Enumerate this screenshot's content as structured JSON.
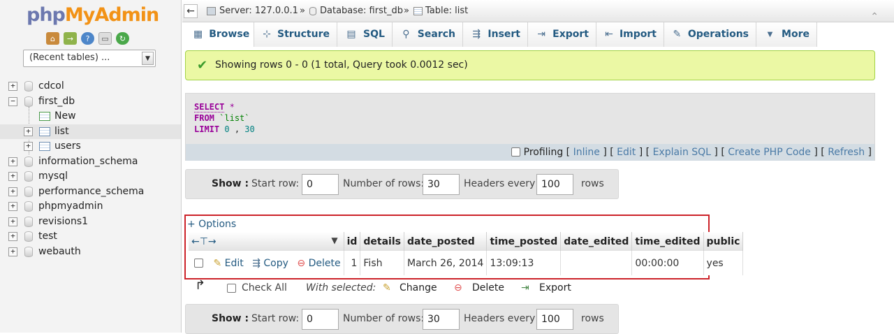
{
  "sidebar": {
    "logo_php": "php",
    "logo_myadmin": "MyAdmin",
    "quick_icons": [
      "home-icon",
      "logout-icon",
      "help-icon",
      "docs-icon",
      "reload-icon"
    ],
    "recent_tables": "(Recent tables) ...",
    "databases": [
      {
        "label": "cdcol",
        "expander": "+"
      },
      {
        "label": "first_db",
        "expander": "−"
      },
      {
        "label": "information_schema",
        "expander": "+"
      },
      {
        "label": "mysql",
        "expander": "+"
      },
      {
        "label": "performance_schema",
        "expander": "+"
      },
      {
        "label": "phpmyadmin",
        "expander": "+"
      },
      {
        "label": "revisions1",
        "expander": "+"
      },
      {
        "label": "test",
        "expander": "+"
      },
      {
        "label": "webauth",
        "expander": "+"
      }
    ],
    "first_db_children": [
      {
        "label": "New"
      },
      {
        "label": "list",
        "expander": "+"
      },
      {
        "label": "users",
        "expander": "+"
      }
    ]
  },
  "breadcrumb": {
    "server": "Server: 127.0.0.1",
    "sep": "»",
    "database": "Database: first_db",
    "table": "Table: list"
  },
  "tabs": [
    {
      "label": "Browse",
      "icon": "browse-icon",
      "glyph": "▦"
    },
    {
      "label": "Structure",
      "icon": "structure-icon",
      "glyph": "⊹"
    },
    {
      "label": "SQL",
      "icon": "sql-icon",
      "glyph": "▤"
    },
    {
      "label": "Search",
      "icon": "search-icon",
      "glyph": "⚲"
    },
    {
      "label": "Insert",
      "icon": "insert-icon",
      "glyph": "⇶"
    },
    {
      "label": "Export",
      "icon": "export-icon",
      "glyph": "⇥"
    },
    {
      "label": "Import",
      "icon": "import-icon",
      "glyph": "⇤"
    },
    {
      "label": "Operations",
      "icon": "wrench-icon",
      "glyph": "✎"
    },
    {
      "label": "More",
      "icon": "chevron-down-icon",
      "glyph": "▼"
    }
  ],
  "message": "Showing rows 0 - 0 (1 total, Query took 0.0012 sec)",
  "sql": {
    "select": "SELECT",
    "star": "*",
    "from": "FROM",
    "table": "`list`",
    "limit": "LIMIT",
    "offset": "0",
    "comma": ",",
    "count": "30"
  },
  "sql_links": {
    "profiling": "Profiling",
    "inline": "Inline",
    "edit": "Edit",
    "explain": "Explain SQL",
    "create_php": "Create PHP Code",
    "refresh": "Refresh"
  },
  "nav": {
    "show": "Show :",
    "start_row_label": "Start row:",
    "start_row": "0",
    "num_rows_label": "Number of rows:",
    "num_rows": "30",
    "headers_every_label": "Headers every",
    "headers_every": "100",
    "rows_label": "rows"
  },
  "options_link": "+ Options",
  "columns": [
    "id",
    "details",
    "date_posted",
    "time_posted",
    "date_edited",
    "time_edited",
    "public"
  ],
  "rows": [
    {
      "edit": "Edit",
      "copy": "Copy",
      "delete": "Delete",
      "cells": [
        "1",
        "Fish",
        "March 26, 2014",
        "13:09:13",
        "",
        "00:00:00",
        "yes"
      ]
    }
  ],
  "bulk": {
    "check_all": "Check All",
    "with_selected": "With selected:",
    "change": "Change",
    "delete": "Delete",
    "export": "Export"
  }
}
